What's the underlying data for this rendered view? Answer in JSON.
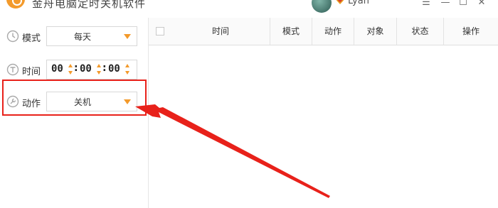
{
  "window": {
    "title": "金舟电脑定时关机软件",
    "username": "Lyan",
    "controls": {
      "menu": "☰",
      "minimize": "—",
      "maximize": "☐",
      "close": "✕"
    }
  },
  "form": {
    "mode": {
      "label": "模式",
      "value": "每天"
    },
    "time": {
      "label": "时间",
      "hours": "00",
      "minutes": "00",
      "seconds": "00",
      "separator": ":"
    },
    "action": {
      "label": "动作",
      "value": "关机"
    }
  },
  "table": {
    "columns": [
      "时间",
      "模式",
      "动作",
      "对象",
      "状态",
      "操作"
    ],
    "rows": []
  },
  "colors": {
    "accent": "#f39a2b",
    "annotation": "#e8211a"
  }
}
